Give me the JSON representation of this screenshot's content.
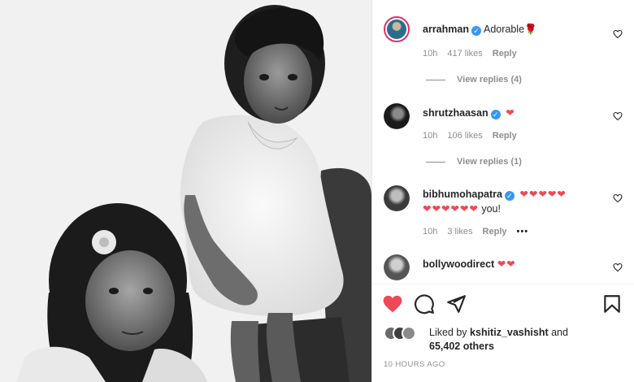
{
  "post": {
    "image_alt": "Vintage black-and-white photo of two young children",
    "time_ago": "10 HOURS AGO"
  },
  "comments": [
    {
      "username": "arrahman",
      "verified": true,
      "text": "Adorable",
      "emoji": "🌹",
      "time": "10h",
      "likes": "417 likes",
      "reply": "Reply",
      "view_replies": "View replies (4)"
    },
    {
      "username": "shrutzhaasan",
      "verified": true,
      "text": "",
      "emoji": "❤",
      "time": "10h",
      "likes": "106 likes",
      "reply": "Reply",
      "view_replies": "View replies (1)"
    },
    {
      "username": "bibhumohapatra",
      "verified": true,
      "emoji_line1": "❤❤❤❤❤",
      "emoji_line2": "❤❤❤❤❤❤",
      "text": "you!",
      "time": "10h",
      "likes": "3 likes",
      "reply": "Reply",
      "more": "•••"
    },
    {
      "username": "bollywoodirect",
      "verified": false,
      "emoji": "❤❤"
    }
  ],
  "likes": {
    "prefix": "Liked by",
    "user": "kshitiz_vashisht",
    "joiner": "and",
    "others": "65,402 others"
  },
  "icons": {
    "like": "heart-filled-icon",
    "comment": "comment-icon",
    "share": "send-icon",
    "save": "bookmark-icon",
    "comment_like": "heart-outline-icon"
  },
  "colors": {
    "like_red": "#ed4956",
    "verified_blue": "#3897f0",
    "muted": "#8e8e8e"
  }
}
